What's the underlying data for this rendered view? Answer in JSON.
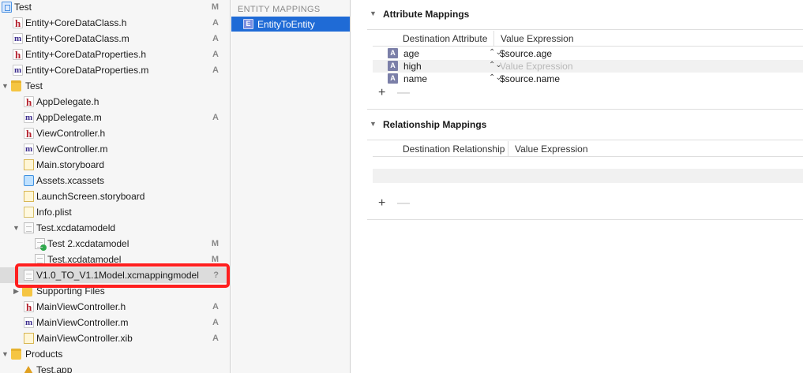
{
  "navigator": {
    "rows": [
      {
        "label": "Test",
        "icon": "project",
        "status": "M"
      },
      {
        "label": "Entity+CoreDataClass.h",
        "icon": "h",
        "status": "A"
      },
      {
        "label": "Entity+CoreDataClass.m",
        "icon": "m",
        "status": "A"
      },
      {
        "label": "Entity+CoreDataProperties.h",
        "icon": "h",
        "status": "A"
      },
      {
        "label": "Entity+CoreDataProperties.m",
        "icon": "m",
        "status": "A"
      },
      {
        "label": "Test",
        "icon": "folder",
        "status": ""
      },
      {
        "label": "AppDelegate.h",
        "icon": "h",
        "status": ""
      },
      {
        "label": "AppDelegate.m",
        "icon": "m",
        "status": "A"
      },
      {
        "label": "ViewController.h",
        "icon": "h",
        "status": ""
      },
      {
        "label": "ViewController.m",
        "icon": "m",
        "status": ""
      },
      {
        "label": "Main.storyboard",
        "icon": "storyboard",
        "status": ""
      },
      {
        "label": "Assets.xcassets",
        "icon": "assets",
        "status": ""
      },
      {
        "label": "LaunchScreen.storyboard",
        "icon": "storyboard",
        "status": ""
      },
      {
        "label": "Info.plist",
        "icon": "plist",
        "status": ""
      },
      {
        "label": "Test.xcdatamodeld",
        "icon": "doc",
        "status": ""
      },
      {
        "label": "Test 2.xcdatamodel",
        "icon": "doc-check",
        "status": "M"
      },
      {
        "label": "Test.xcdatamodel",
        "icon": "doc",
        "status": "M"
      },
      {
        "label": "V1.0_TO_V1.1Model.xcmappingmodel",
        "icon": "doc",
        "status": "?"
      },
      {
        "label": "Supporting Files",
        "icon": "folder",
        "status": ""
      },
      {
        "label": "MainViewController.h",
        "icon": "h",
        "status": "A"
      },
      {
        "label": "MainViewController.m",
        "icon": "m",
        "status": "A"
      },
      {
        "label": "MainViewController.xib",
        "icon": "storyboard",
        "status": "A"
      },
      {
        "label": "Products",
        "icon": "folder",
        "status": ""
      },
      {
        "label": "Test.app",
        "icon": "app",
        "status": ""
      }
    ]
  },
  "entity_mappings": {
    "title": "ENTITY MAPPINGS",
    "selected": {
      "icon_letter": "E",
      "label": "EntityToEntity"
    }
  },
  "attribute_mappings": {
    "title": "Attribute Mappings",
    "col_destination": "Destination Attribute",
    "col_value": "Value Expression",
    "rows": [
      {
        "icon_letter": "A",
        "name": "age",
        "value": "$source.age",
        "placeholder": false
      },
      {
        "icon_letter": "A",
        "name": "high",
        "value": "Value Expression",
        "placeholder": true
      },
      {
        "icon_letter": "A",
        "name": "name",
        "value": "$source.name",
        "placeholder": false
      }
    ],
    "add": "+",
    "remove": "—"
  },
  "relationship_mappings": {
    "title": "Relationship Mappings",
    "col_destination": "Destination Relationship",
    "col_value": "Value Expression",
    "add": "+",
    "remove": "—"
  },
  "colors": {
    "selection": "#1f6bd6",
    "highlight_box": "#ff1f1f",
    "sidebar_bg": "#f6f6f6"
  }
}
